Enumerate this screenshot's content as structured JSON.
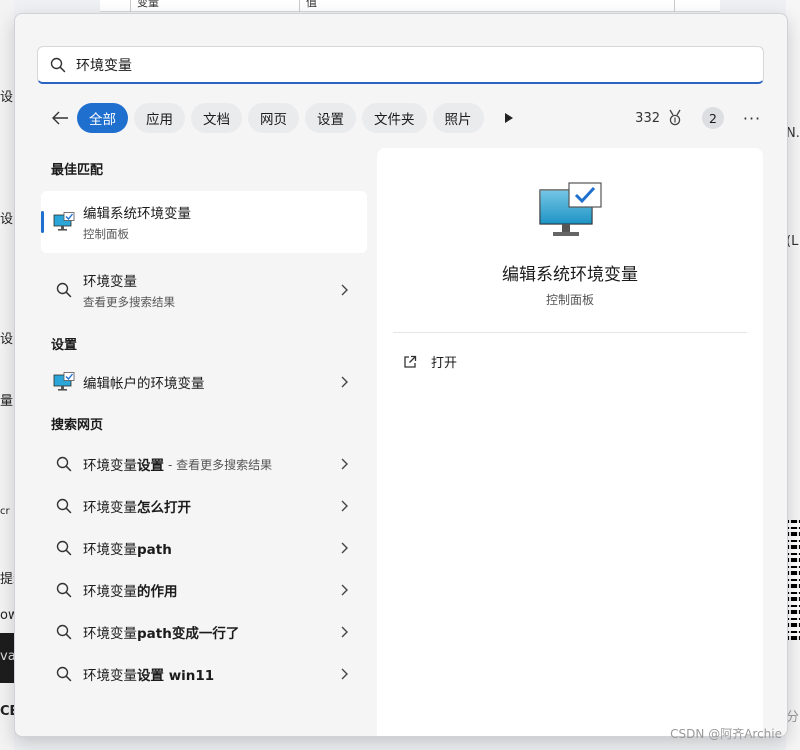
{
  "background": {
    "top_cells": [
      "变量",
      "值"
    ],
    "left_fragments": [
      "设",
      "设",
      "设",
      "量",
      "cr",
      "提示",
      "ow",
      "va",
      "CE"
    ],
    "right_fragments": [
      "N.",
      "(L",
      "分"
    ],
    "watermark": "CSDN @阿齐Archie"
  },
  "search": {
    "query": "环境变量",
    "placeholder": ""
  },
  "filters": {
    "chips": [
      "全部",
      "应用",
      "文档",
      "网页",
      "设置",
      "文件夹",
      "照片"
    ],
    "active_index": 0,
    "points": "332",
    "badge": "2",
    "more": "···"
  },
  "sections": {
    "best_match": "最佳匹配",
    "settings": "设置",
    "web": "搜索网页"
  },
  "best_match": {
    "title": "编辑系统环境变量",
    "subtitle": "控制面板"
  },
  "env_item": {
    "title": "环境变量",
    "subtitle": "查看更多搜索结果"
  },
  "settings_item": {
    "title": "编辑帐户的环境变量"
  },
  "web_results": [
    {
      "prefix": "环境变量",
      "bold": "设置",
      "suffix": "- 查看更多搜索结果"
    },
    {
      "prefix": "环境变量",
      "bold": "怎么打开",
      "suffix": ""
    },
    {
      "prefix": "环境变量",
      "bold": "path",
      "suffix": ""
    },
    {
      "prefix": "环境变量",
      "bold": "的作用",
      "suffix": ""
    },
    {
      "prefix": "环境变量",
      "bold": "path变成一行了",
      "suffix": ""
    },
    {
      "prefix": "环境变量",
      "bold": "设置 win11",
      "suffix": ""
    }
  ],
  "preview": {
    "title": "编辑系统环境变量",
    "subtitle": "控制面板",
    "open_label": "打开"
  },
  "colors": {
    "accent": "#1f6fcf",
    "panel": "#f5f5f6"
  }
}
